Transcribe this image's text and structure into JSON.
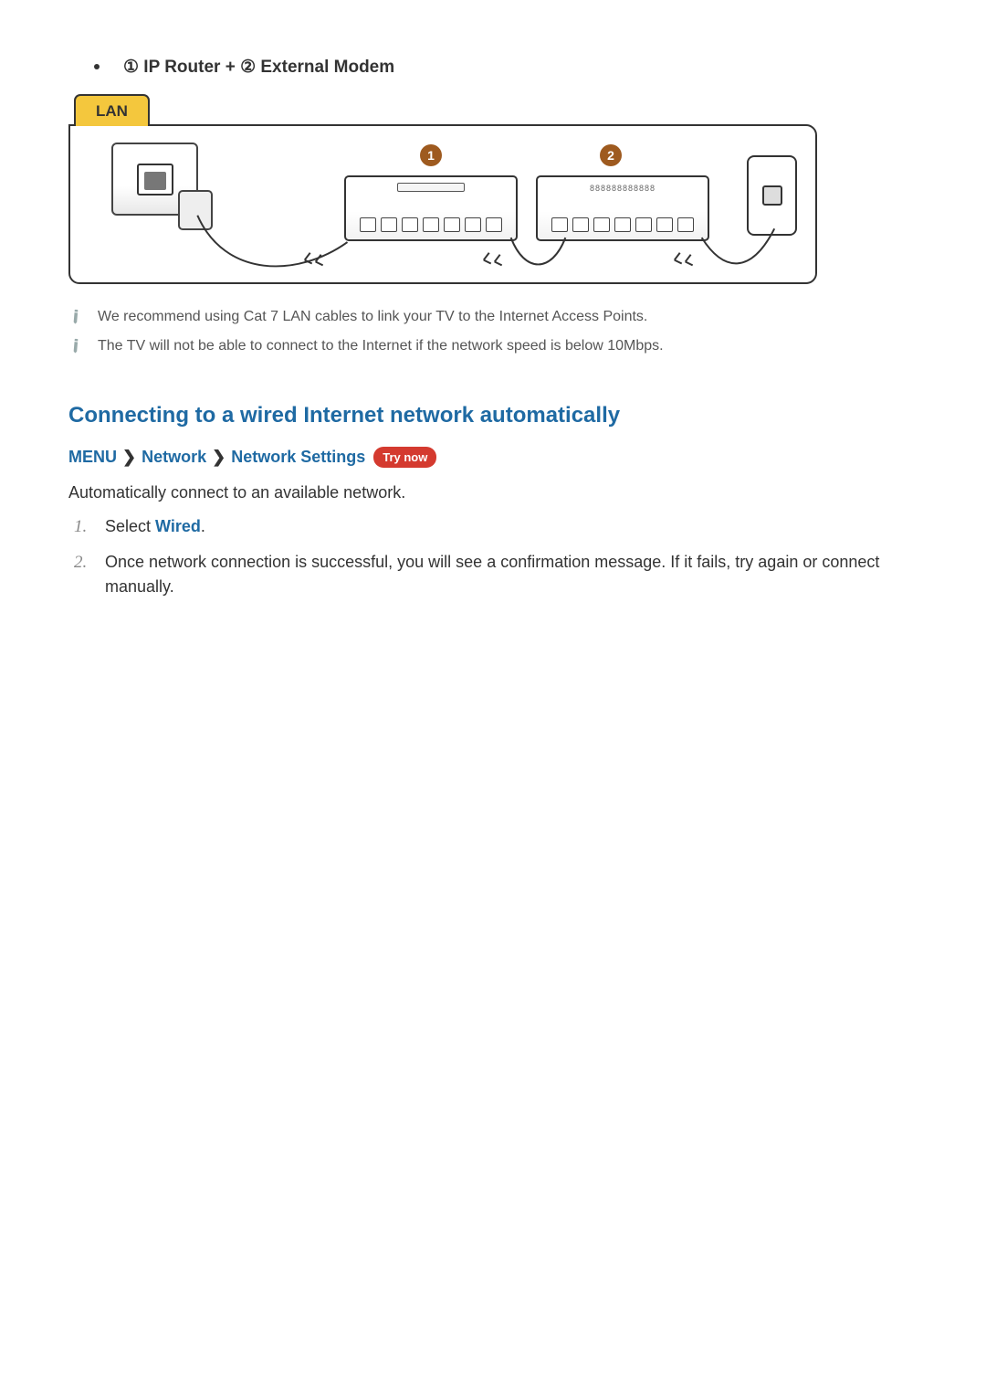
{
  "bullet": {
    "text": "① IP Router + ② External Modem"
  },
  "diagram": {
    "lan_label": "LAN",
    "badge1": "1",
    "badge2": "2"
  },
  "notes": [
    "We recommend using Cat 7 LAN cables to link your TV to the Internet Access Points.",
    "The TV will not be able to connect to the Internet if the network speed is below 10Mbps."
  ],
  "section_heading": "Connecting to a wired Internet network automatically",
  "nav": {
    "menu": "MENU",
    "network": "Network",
    "settings": "Network Settings",
    "try_now": "Try now"
  },
  "intro_text": "Automatically connect to an available network.",
  "steps": [
    {
      "num": "1.",
      "prefix": "Select ",
      "accent": "Wired",
      "suffix": "."
    },
    {
      "num": "2.",
      "text": "Once network connection is successful, you will see a confirmation message. If it fails, try again or connect manually."
    }
  ]
}
